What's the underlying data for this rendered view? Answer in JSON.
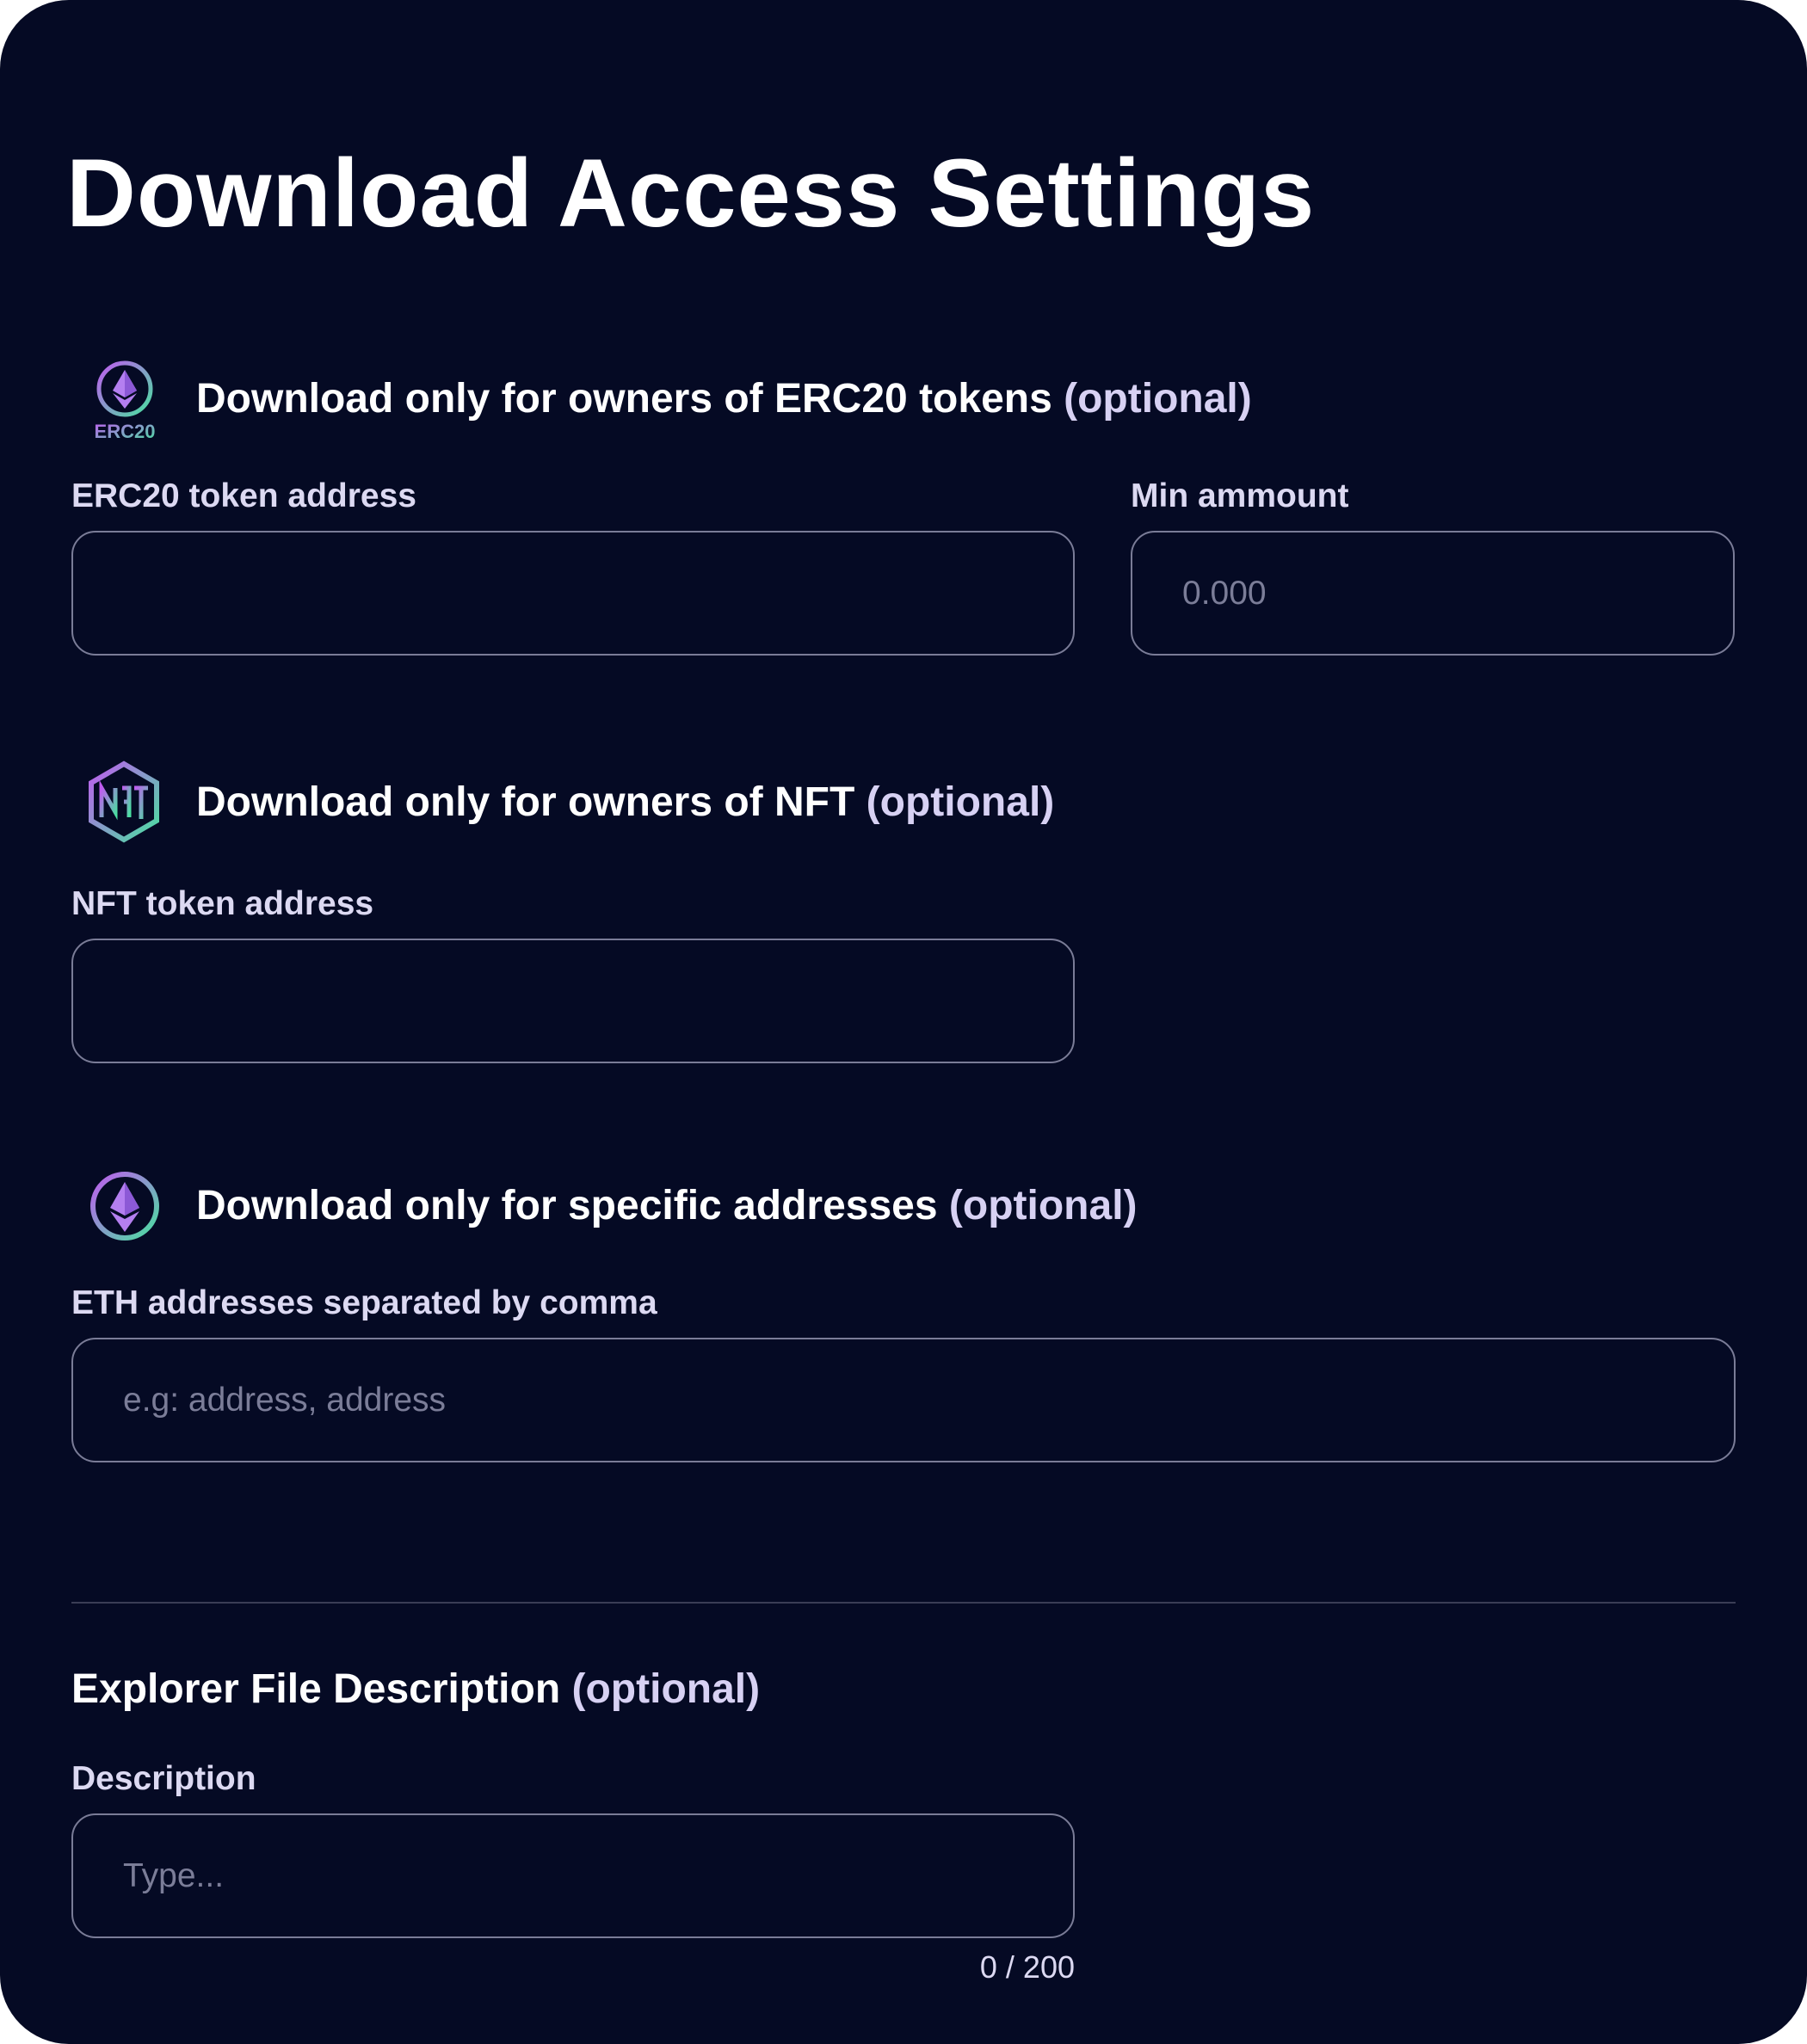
{
  "page": {
    "title": "Download Access Settings",
    "colors": {
      "background": "#050a24",
      "border": "#7a7c97",
      "gradient_purple": "#c05bf0",
      "gradient_green": "#49e0a0"
    }
  },
  "erc20": {
    "icon": "erc20-eth-icon",
    "icon_text": "ERC20",
    "heading": "Download only for owners of ERC20 tokens",
    "heading_optional": "(optional)",
    "address_label": "ERC20 token address",
    "address_value": "",
    "amount_label": "Min ammount",
    "amount_placeholder": "0.000"
  },
  "nft": {
    "icon": "nft-hexagon-icon",
    "heading": "Download only for owners of NFT",
    "heading_optional": "(optional)",
    "address_label": "NFT token address",
    "address_value": ""
  },
  "addresses": {
    "icon": "eth-circle-icon",
    "heading": "Download only for specific addresses",
    "heading_optional": "(optional)",
    "label": "ETH addresses separated by comma",
    "placeholder": "e.g: address, address"
  },
  "description": {
    "heading": "Explorer File Description",
    "heading_optional": "(optional)",
    "label": "Description",
    "placeholder": "Type...",
    "counter": "0 / 200"
  }
}
